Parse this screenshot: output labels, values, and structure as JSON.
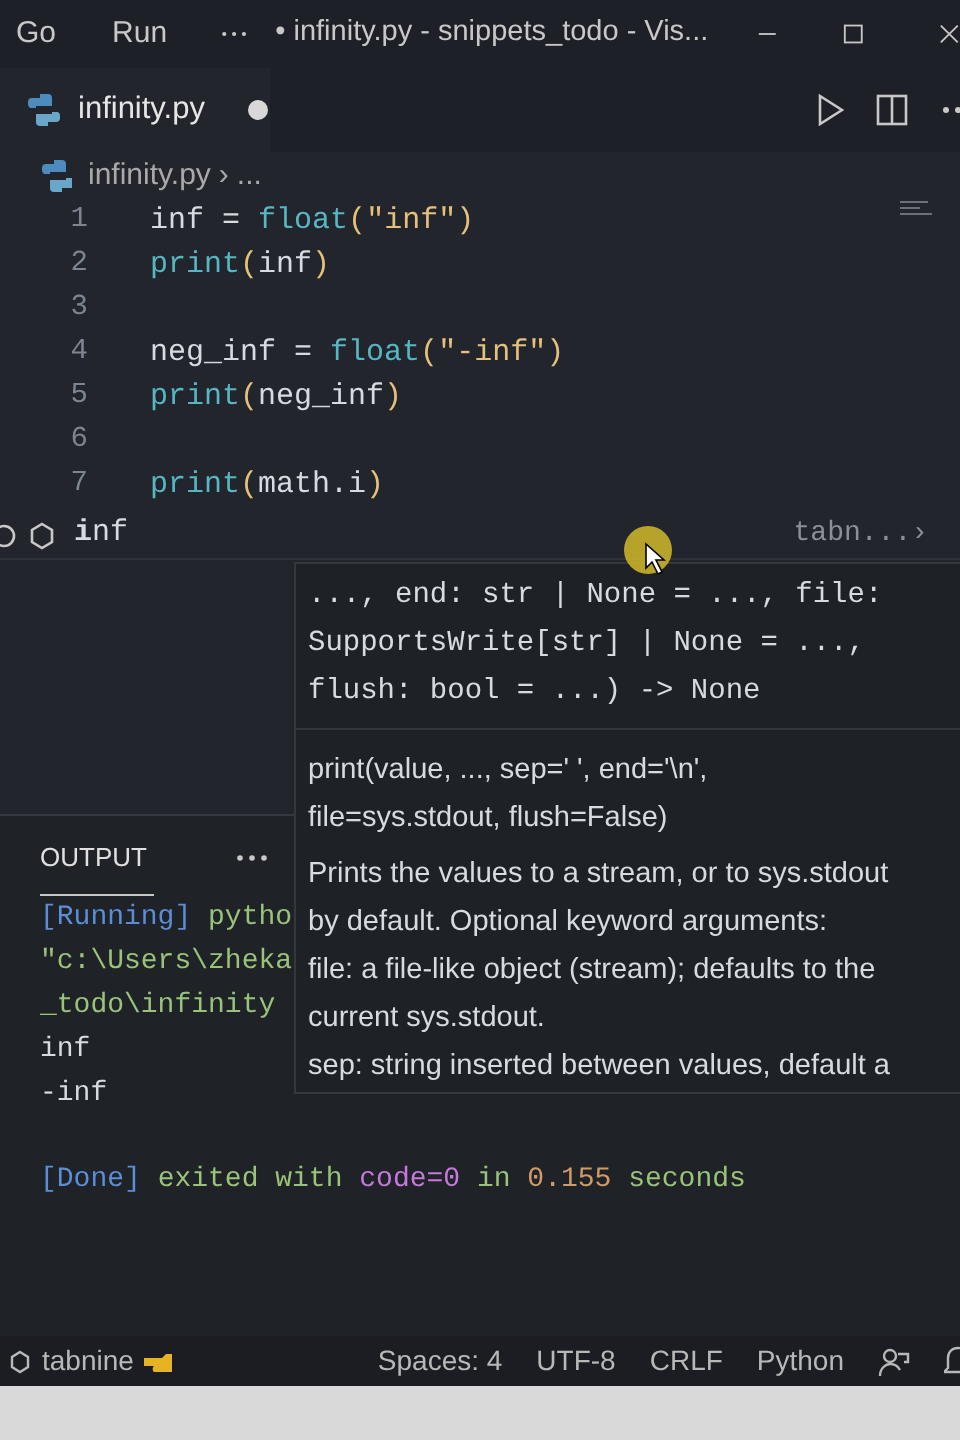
{
  "title_bar": {
    "menus": [
      "Go",
      "Run"
    ],
    "title": "• infinity.py - snippets_todo - Vis..."
  },
  "tabs": [
    {
      "label": "infinity.py",
      "selected": true,
      "modified": true
    }
  ],
  "breadcrumb": {
    "file": "infinity.py",
    "separator": "›",
    "rest": "..."
  },
  "editor": {
    "lines": [
      {
        "number": "1",
        "tokens": [
          {
            "kind": "var",
            "text": "inf"
          },
          {
            "kind": "op",
            "text": " = "
          },
          {
            "kind": "builtin",
            "text": "float"
          },
          {
            "kind": "paren",
            "text": "("
          },
          {
            "kind": "str",
            "text": "\"inf\""
          },
          {
            "kind": "paren",
            "text": ")"
          }
        ]
      },
      {
        "number": "2",
        "tokens": [
          {
            "kind": "builtin",
            "text": "print"
          },
          {
            "kind": "paren",
            "text": "("
          },
          {
            "kind": "var",
            "text": "inf"
          },
          {
            "kind": "paren",
            "text": ")"
          }
        ]
      },
      {
        "number": "3"
      },
      {
        "number": "4",
        "tokens": [
          {
            "kind": "var",
            "text": "neg_inf"
          },
          {
            "kind": "op",
            "text": " = "
          },
          {
            "kind": "builtin",
            "text": "float"
          },
          {
            "kind": "paren",
            "text": "("
          },
          {
            "kind": "str",
            "text": "\"-inf\""
          },
          {
            "kind": "paren",
            "text": ")"
          }
        ]
      },
      {
        "number": "5",
        "tokens": [
          {
            "kind": "builtin",
            "text": "print"
          },
          {
            "kind": "paren",
            "text": "("
          },
          {
            "kind": "var",
            "text": "neg_inf"
          },
          {
            "kind": "paren",
            "text": ")"
          }
        ]
      },
      {
        "number": "6"
      },
      {
        "number": "7",
        "tokens": [
          {
            "kind": "builtin",
            "text": "print"
          },
          {
            "kind": "paren",
            "text": "("
          },
          {
            "kind": "var",
            "text": "math.i"
          },
          {
            "kind": "paren",
            "text": ")"
          }
        ]
      }
    ]
  },
  "suggestion": {
    "label": "**i**nf",
    "source": "tabn...›"
  },
  "hover": {
    "signature_lines": [
      "..., end: str | None = ..., file:",
      "SupportsWrite[str] | None = ...,",
      "flush: bool = ...) -> None"
    ],
    "doc_lines": [
      "print(value, ..., sep=' ', end='\\n',",
      "file=sys.stdout, flush=False)"
    ],
    "description_lines": [
      "Prints the values to a stream, or to sys.stdout",
      "by default. Optional keyword arguments:",
      "file: a file-like object (stream); defaults to the",
      "current sys.stdout.",
      "sep: string inserted between values, default a"
    ]
  },
  "panel": {
    "tabs": [
      {
        "label": "OUTPUT",
        "selected": true
      }
    ],
    "lines": [
      {
        "kind": "log",
        "tokens": [
          {
            "kind": "tag",
            "text": "[Running]"
          },
          {
            "kind": "green",
            "text": " pytho"
          }
        ]
      },
      {
        "kind": "log",
        "tokens": [
          {
            "kind": "green",
            "text": "\"c:\\Users\\zheka"
          }
        ]
      },
      {
        "kind": "log",
        "tokens": [
          {
            "kind": "green",
            "text": "_todo\\infinity"
          }
        ]
      },
      {
        "kind": "log",
        "tokens": [
          {
            "kind": "plain",
            "text": "inf"
          }
        ]
      },
      {
        "kind": "log",
        "tokens": [
          {
            "kind": "plain",
            "text": "-inf"
          }
        ]
      },
      {
        "kind": "status",
        "tokens": [
          {
            "kind": "tag",
            "text": "[Done]"
          },
          {
            "kind": "green",
            "text": " exited with"
          },
          {
            "kind": "purple",
            "text": " code=0"
          },
          {
            "kind": "green",
            "text": " in"
          },
          {
            "kind": "orange",
            "text": " 0.155"
          },
          {
            "kind": "green",
            "text": " seconds"
          }
        ]
      }
    ]
  },
  "status_bar": {
    "left": "tabnine",
    "right": [
      "Spaces: 4",
      "UTF-8",
      "CRLF",
      "Python"
    ]
  }
}
